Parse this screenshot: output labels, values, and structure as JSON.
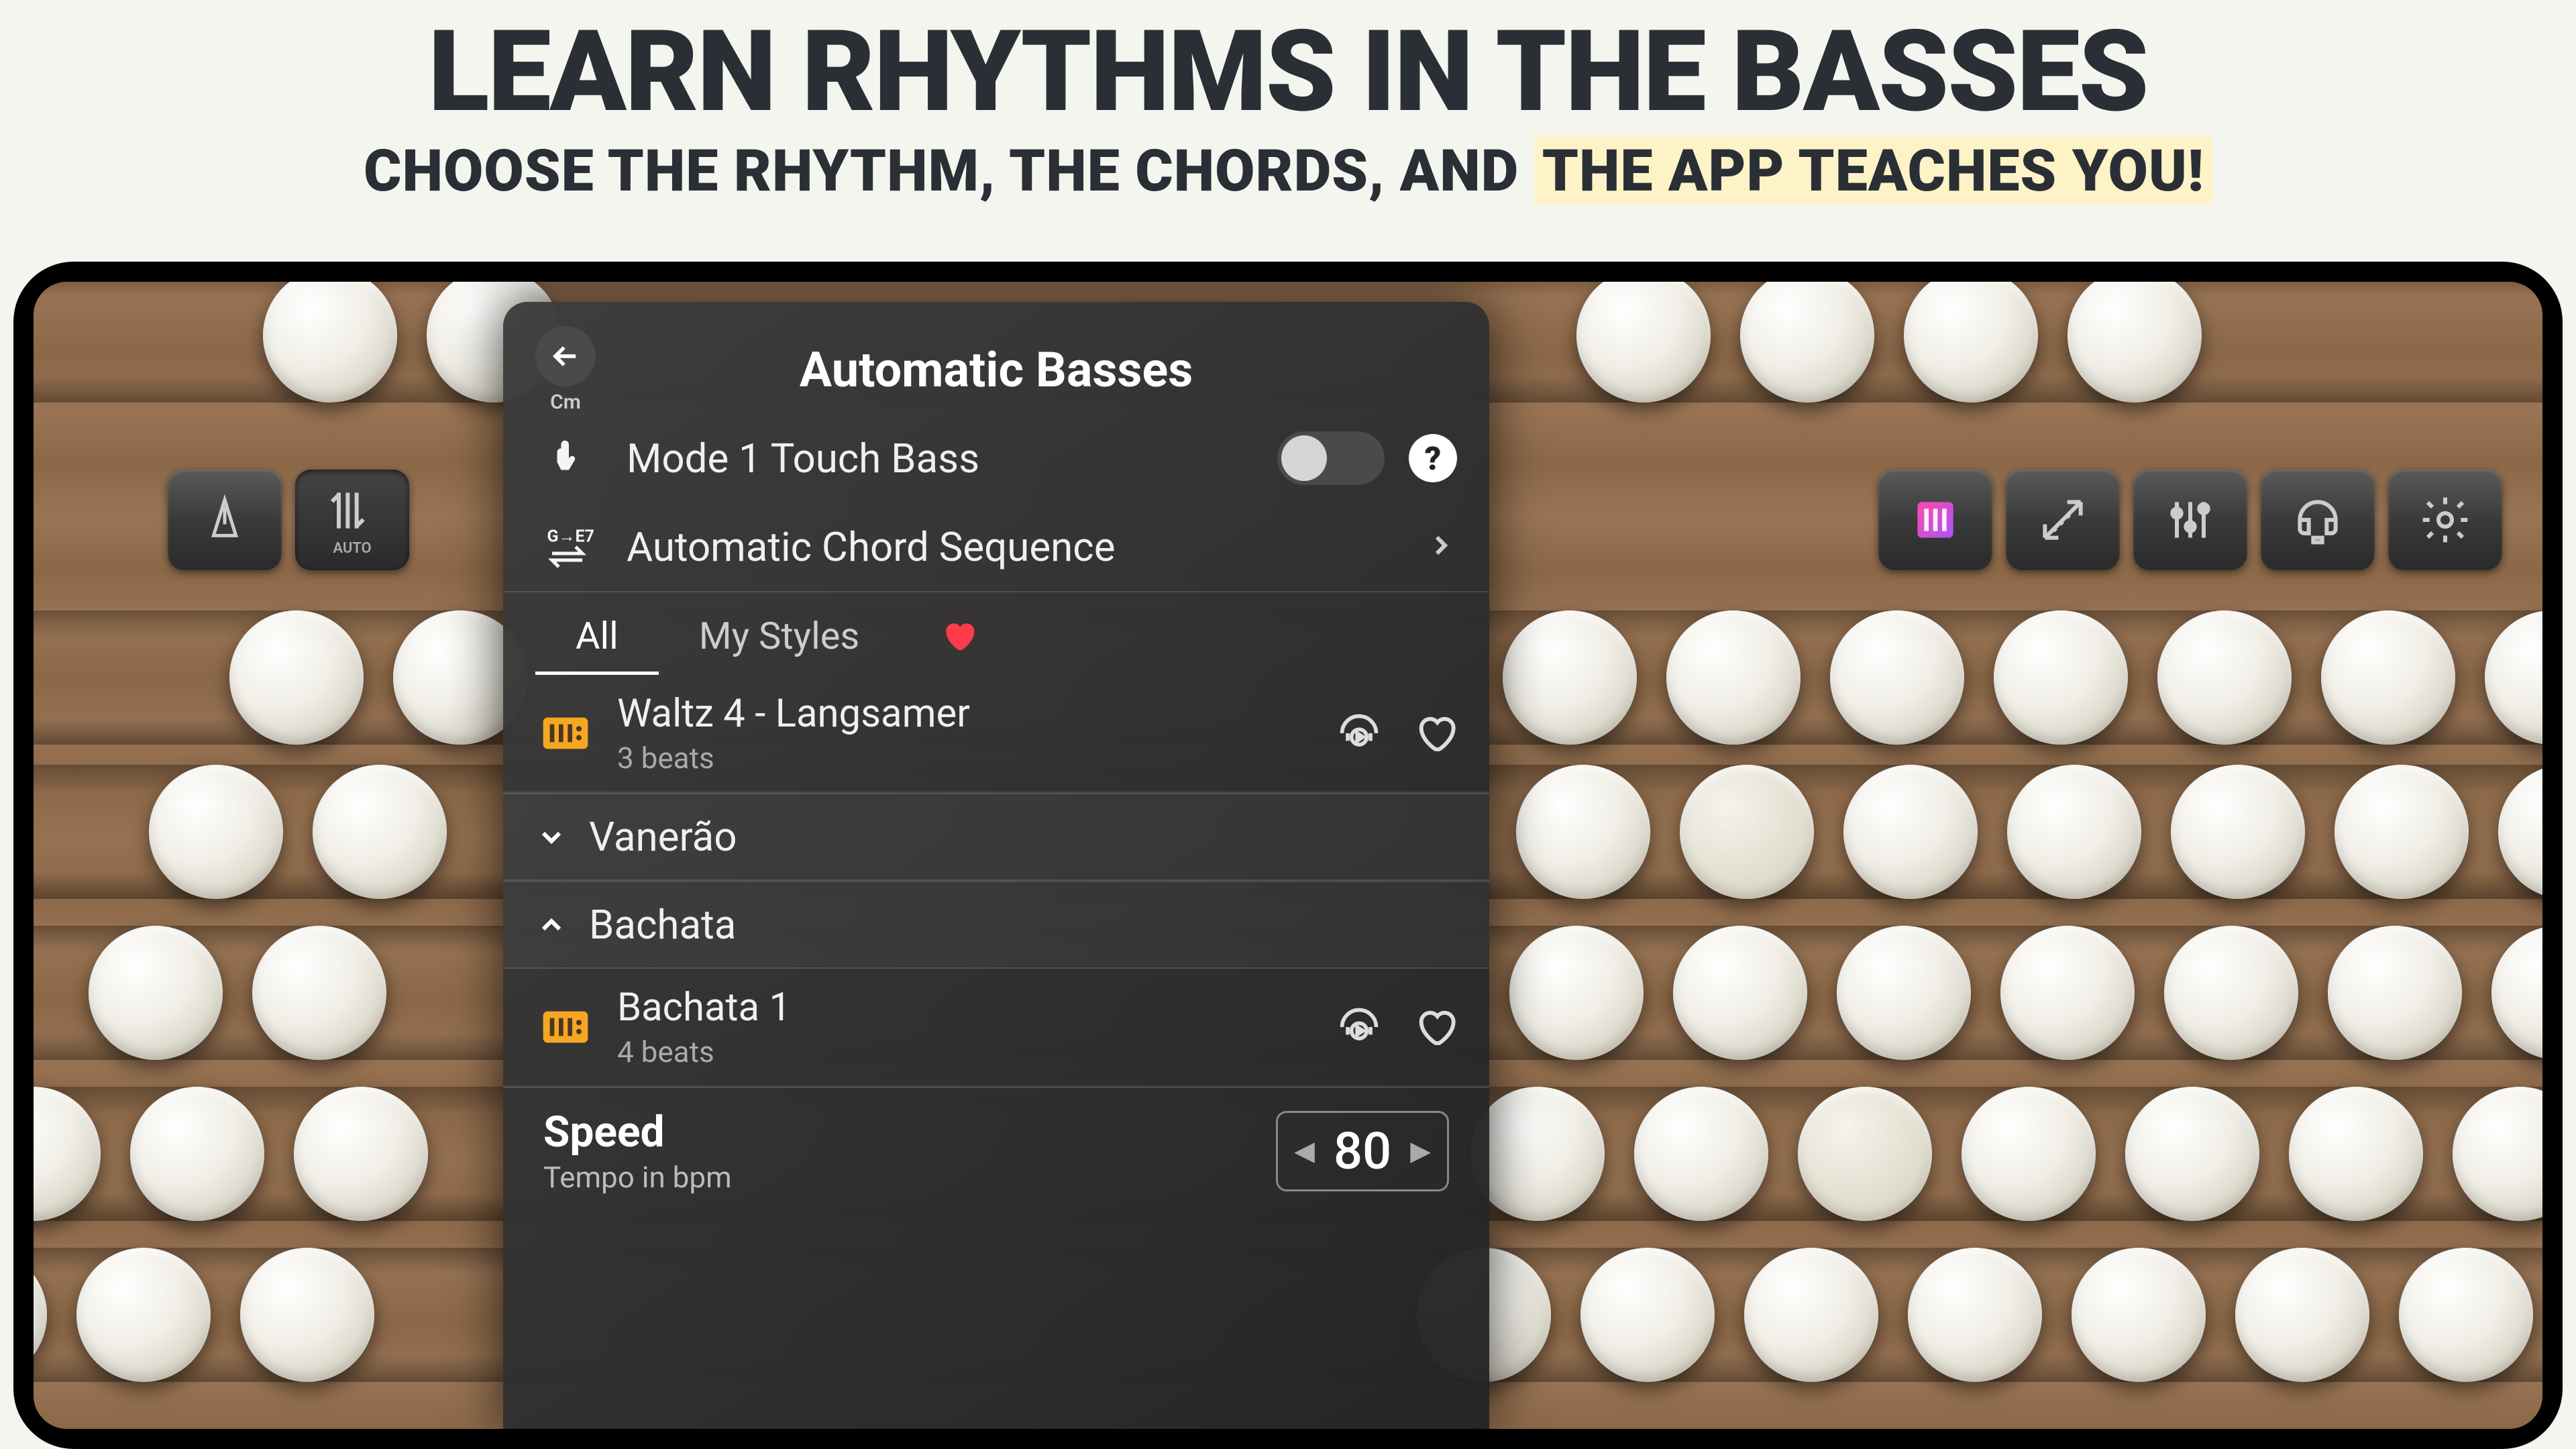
{
  "headline": {
    "line1": "LEARN RHYTHMS IN THE BASSES",
    "line2_a": "CHOOSE THE RHYTHM, THE CHORDS, AND ",
    "line2_b": "THE APP TEACHES YOU!"
  },
  "toolbar": {
    "auto_label": "AUTO"
  },
  "panel": {
    "title": "Automatic Basses",
    "back_sub": "Cm",
    "mode_row": {
      "label": "Mode 1 Touch Bass",
      "toggle": false
    },
    "seq_row": {
      "label": "Automatic Chord Sequence",
      "icon_label": "G→E7"
    },
    "tabs": {
      "all": "All",
      "my": "My Styles"
    },
    "styles": [
      {
        "name": "Waltz 4 - Langsamer",
        "beats": "3 beats"
      }
    ],
    "categories": [
      {
        "name": "Vanerão",
        "expanded": false
      },
      {
        "name": "Bachata",
        "expanded": true,
        "items": [
          {
            "name": "Bachata 1",
            "beats": "4 beats"
          }
        ]
      }
    ],
    "speed": {
      "title": "Speed",
      "sub": "Tempo in bpm",
      "value": "80"
    }
  }
}
